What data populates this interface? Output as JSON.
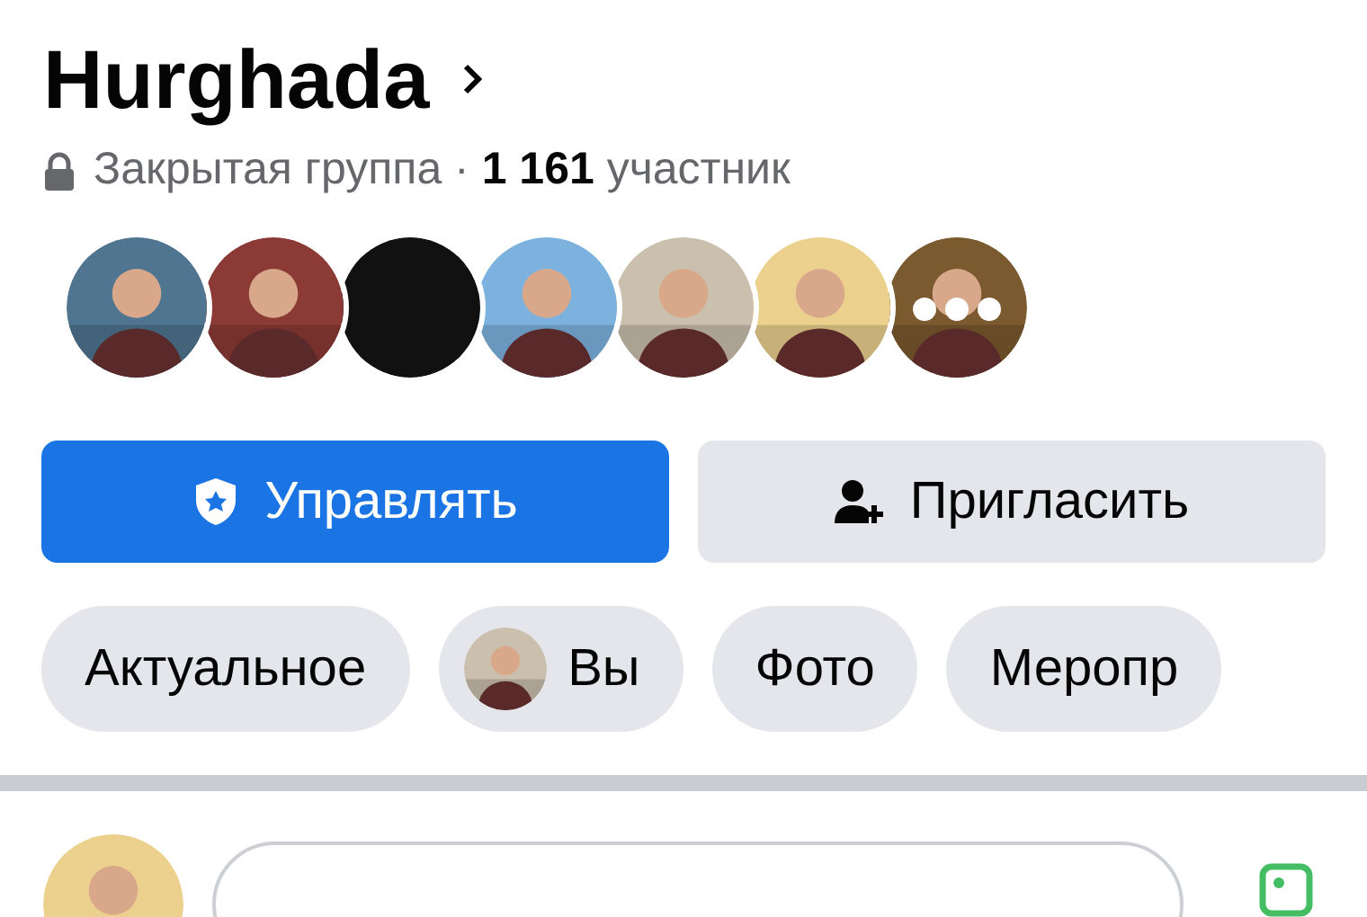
{
  "group": {
    "name": "Hurghada",
    "subtitle": "Закрытая группа · **1 161** участник"
  },
  "members": [
    {
      "kind": "picture"
    },
    {
      "kind": "picture"
    },
    {
      "kind": "picture"
    },
    {
      "kind": "picture"
    },
    {
      "kind": "picture"
    },
    {
      "kind": "picture"
    },
    {
      "kind": "more"
    }
  ],
  "actions": [
    {
      "label": "Управлять",
      "kind": "primary"
    },
    {
      "label": "Пригласить",
      "kind": "secondary"
    }
  ],
  "chips": [
    {
      "label": "Актуальное",
      "kind": "text"
    },
    {
      "label": "Вы",
      "kind": "avatar"
    },
    {
      "label": "Фото",
      "kind": "text"
    },
    {
      "label": "Меропр",
      "kind": "text"
    }
  ]
}
